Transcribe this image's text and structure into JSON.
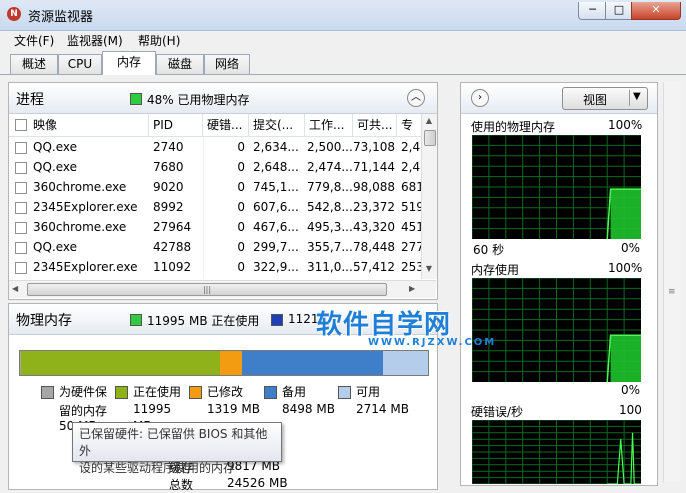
{
  "window": {
    "title": "资源监视器",
    "app_icon": "resmon-icon",
    "min_glyph": "─",
    "max_glyph": "□",
    "close_glyph": "✕"
  },
  "menu": {
    "items": [
      "文件(F)",
      "监视器(M)",
      "帮助(H)"
    ]
  },
  "tabs": [
    "概述",
    "CPU",
    "内存",
    "磁盘",
    "网络"
  ],
  "active_tab": "内存",
  "process_section": {
    "title": "进程",
    "status_text": "48% 已用物理内存",
    "status_color": "#2ecc40",
    "columns": [
      "映像",
      "PID",
      "硬错...",
      "提交(...",
      "工作...",
      "可共...",
      "专"
    ],
    "rows": [
      {
        "name": "QQ.exe",
        "pid": "2740",
        "hard": "0",
        "commit": "2,634...",
        "working": "2,500...",
        "shareable": "73,108",
        "private": "2,4"
      },
      {
        "name": "QQ.exe",
        "pid": "7680",
        "hard": "0",
        "commit": "2,648...",
        "working": "2,474...",
        "shareable": "71,144",
        "private": "2,4"
      },
      {
        "name": "360chrome.exe",
        "pid": "9020",
        "hard": "0",
        "commit": "745,1...",
        "working": "779,8...",
        "shareable": "98,088",
        "private": "681"
      },
      {
        "name": "2345Explorer.exe",
        "pid": "8992",
        "hard": "0",
        "commit": "607,6...",
        "working": "542,8...",
        "shareable": "23,372",
        "private": "519"
      },
      {
        "name": "360chrome.exe",
        "pid": "27964",
        "hard": "0",
        "commit": "467,6...",
        "working": "495,3...",
        "shareable": "43,320",
        "private": "451"
      },
      {
        "name": "QQ.exe",
        "pid": "42788",
        "hard": "0",
        "commit": "299,7...",
        "working": "355,7...",
        "shareable": "78,448",
        "private": "277"
      },
      {
        "name": "2345Explorer.exe",
        "pid": "11092",
        "hard": "0",
        "commit": "322,9...",
        "working": "311,0...",
        "shareable": "57,412",
        "private": "253"
      }
    ]
  },
  "physical_memory": {
    "title": "物理内存",
    "in_use_text": "11995 MB 正在使用",
    "available_text": "11212",
    "bar_fractions": {
      "reserved": 0.003,
      "in_use": 0.4876,
      "modified": 0.0536,
      "standby": 0.3454,
      "free": 0.1103
    },
    "colors": {
      "reserved": "#a6a6a6",
      "in_use": "#8fb21a",
      "modified": "#f39c12",
      "standby": "#3f7fc9",
      "free": "#b4cdeb"
    },
    "legend": [
      {
        "key": "reserved",
        "label": "为硬件保",
        "value": "留的内存"
      },
      {
        "key": "in_use",
        "label": "正在使用",
        "value": "11995"
      },
      {
        "key": "modified",
        "label": "已修改",
        "value": "1319 MB"
      },
      {
        "key": "standby",
        "label": "备用",
        "value": "8498 MB"
      },
      {
        "key": "free",
        "label": "可用",
        "value": "2714 MB"
      }
    ],
    "reserved_value_partial": "50 MB",
    "in_use_unit_partial": "MB",
    "cached_label": "缓存",
    "cached_value": "9817 MB",
    "total_label_partial": "总数",
    "total_value_partial": "24526 MB"
  },
  "tooltip": {
    "line1": "已保留硬件: 已保留供 BIOS 和其他外",
    "line2": "设的某些驱动程序使用的内存"
  },
  "right_pane": {
    "view_button": "视图",
    "graphs": [
      {
        "title": "使用的物理内存",
        "max": "100%",
        "time": "60 秒",
        "min": "0%",
        "level": 0.48
      },
      {
        "title": "内存使用",
        "max": "100%",
        "min": "0%",
        "level": 0.45
      },
      {
        "title": "硬错误/秒",
        "max": "100"
      }
    ]
  },
  "watermark": {
    "main": "软件自学网",
    "sub": "WWW.RJZXW.COM"
  }
}
